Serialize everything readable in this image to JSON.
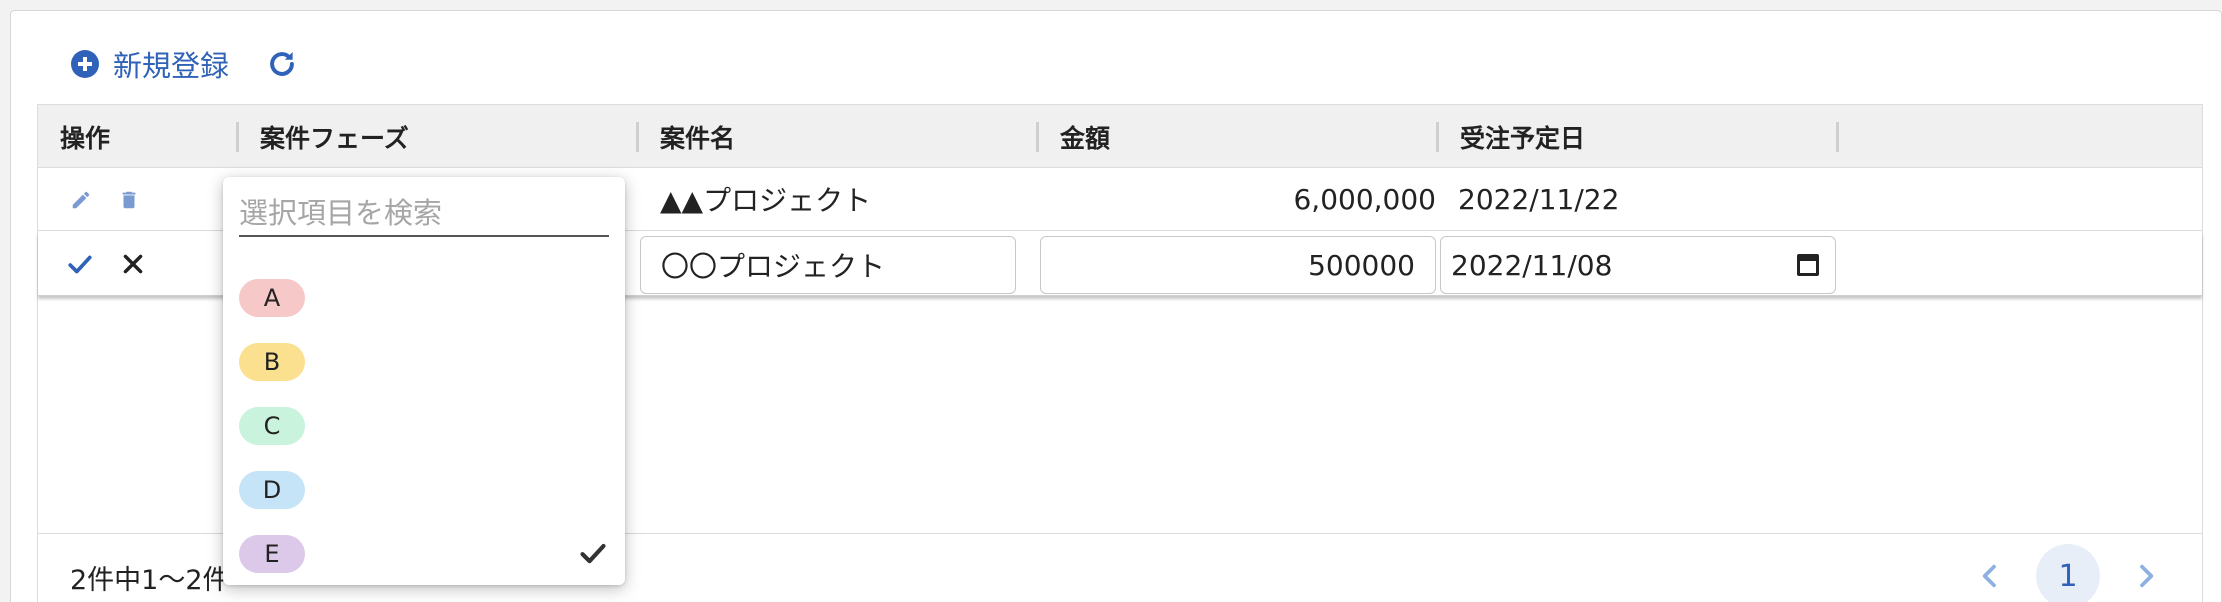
{
  "toolbar": {
    "add_label": "新規登録"
  },
  "columns": [
    "操作",
    "案件フェーズ",
    "案件名",
    "金額",
    "受注予定日"
  ],
  "rows": [
    {
      "name": "▲▲プロジェクト",
      "amount": "6,000,000",
      "date": "2022/11/22"
    }
  ],
  "edit_row": {
    "name": "〇〇プロジェクト",
    "amount": "500000",
    "date": "2022/11/08"
  },
  "dropdown": {
    "search_placeholder": "選択項目を検索",
    "options": [
      {
        "label": "A",
        "color": "#f7c8c8"
      },
      {
        "label": "B",
        "color": "#fbe08f"
      },
      {
        "label": "C",
        "color": "#c9f3dc"
      },
      {
        "label": "D",
        "color": "#c6e4f7"
      },
      {
        "label": "E",
        "color": "#dcc9e9"
      }
    ],
    "selected": "E"
  },
  "footer": {
    "summary": "2件中1〜2件"
  },
  "pager": {
    "current": "1"
  },
  "colors": {
    "accent": "#2f62b8"
  },
  "icons": [
    "plus-circle-icon",
    "refresh-icon",
    "pencil-icon",
    "trash-icon",
    "check-icon",
    "close-icon",
    "calendar-icon",
    "chevron-left-icon",
    "chevron-right-icon"
  ]
}
